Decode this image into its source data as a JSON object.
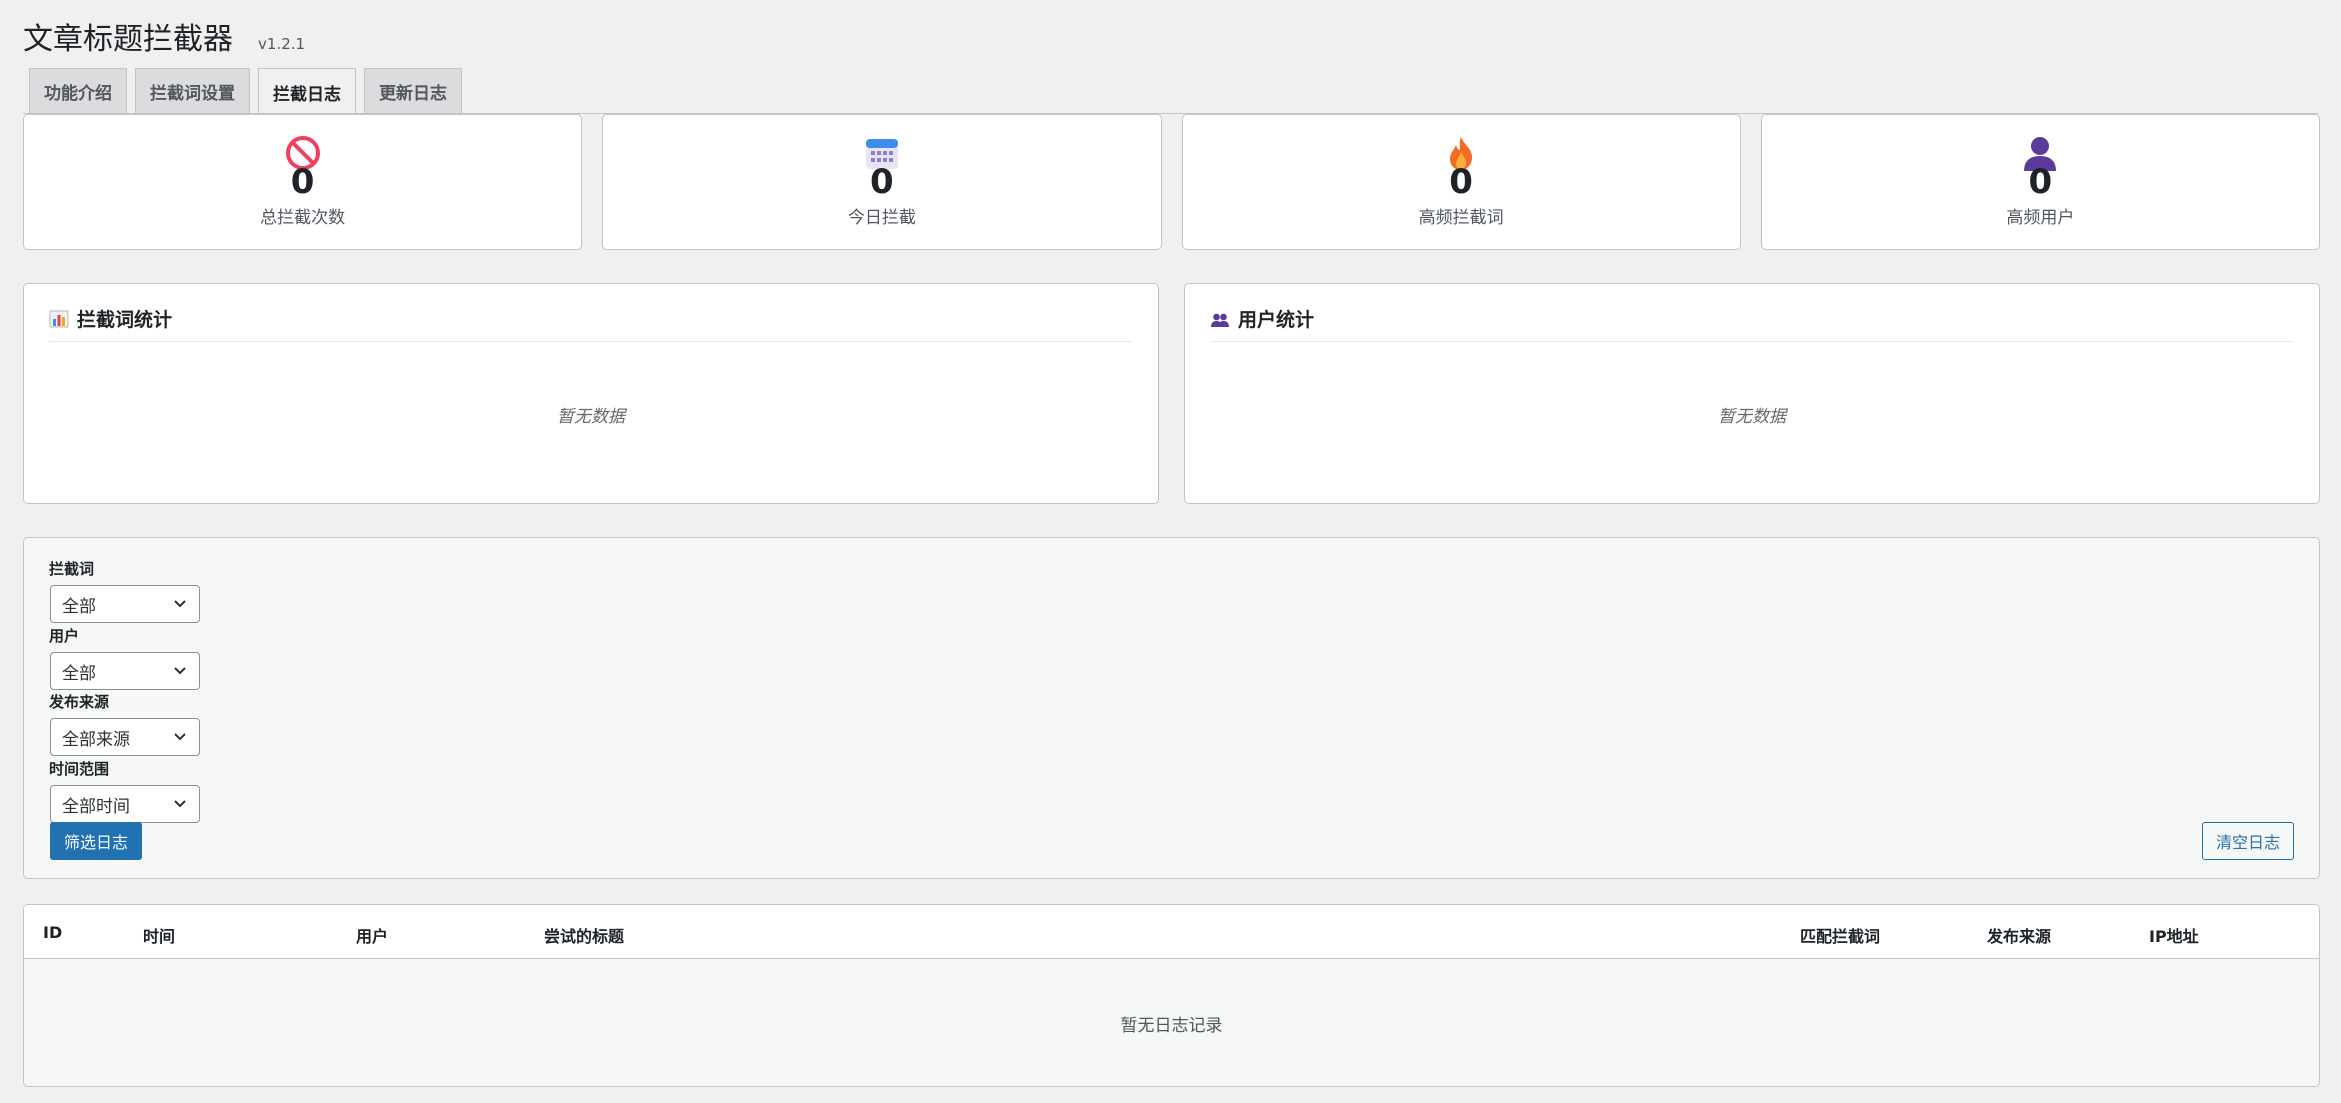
{
  "header": {
    "title": "文章标题拦截器",
    "version": "v1.2.1"
  },
  "tabs": [
    {
      "label": "功能介绍",
      "active": false
    },
    {
      "label": "拦截词设置",
      "active": false
    },
    {
      "label": "拦截日志",
      "active": true
    },
    {
      "label": "更新日志",
      "active": false
    }
  ],
  "stats": [
    {
      "icon": "prohibited-icon",
      "value": "0",
      "label": "总拦截次数"
    },
    {
      "icon": "calendar-icon",
      "value": "0",
      "label": "今日拦截"
    },
    {
      "icon": "fire-icon",
      "value": "0",
      "label": "高频拦截词"
    },
    {
      "icon": "user-silhouette-icon",
      "value": "0",
      "label": "高频用户"
    }
  ],
  "panels": {
    "keywords": {
      "icon": "bar-chart-icon",
      "title": "拦截词统计",
      "empty": "暂无数据"
    },
    "users": {
      "icon": "users-icon",
      "title": "用户统计",
      "empty": "暂无数据"
    }
  },
  "filters": {
    "keyword": {
      "label": "拦截词",
      "value": "全部"
    },
    "user": {
      "label": "用户",
      "value": "全部"
    },
    "source": {
      "label": "发布来源",
      "value": "全部来源"
    },
    "time": {
      "label": "时间范围",
      "value": "全部时间"
    },
    "filter_button": "筛选日志",
    "clear_button": "清空日志"
  },
  "table": {
    "columns": [
      "ID",
      "时间",
      "用户",
      "尝试的标题",
      "匹配拦截词",
      "发布来源",
      "IP地址"
    ],
    "empty": "暂无日志记录"
  },
  "colors": {
    "primary": "#2271b1",
    "background": "#f0f0f1"
  }
}
